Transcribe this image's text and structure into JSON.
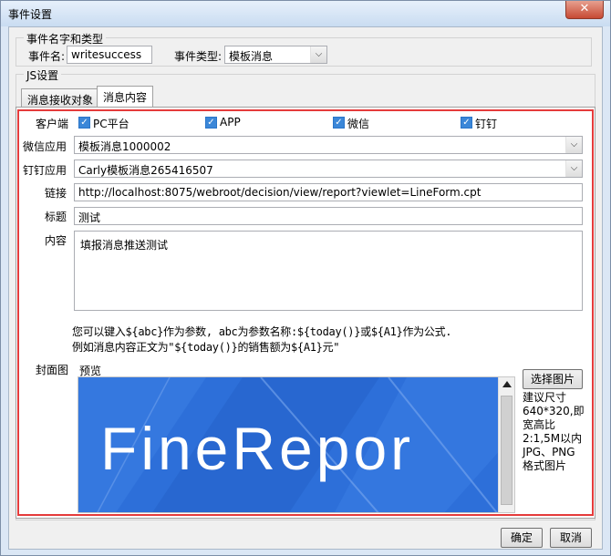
{
  "window": {
    "title": "事件设置",
    "close_symbol": "✕"
  },
  "name_group": {
    "title": "事件名字和类型",
    "name_label": "事件名:",
    "name_value": "writesuccess",
    "type_label": "事件类型:",
    "type_value": "模板消息"
  },
  "js_group": {
    "title": "JS设置"
  },
  "tabs": [
    {
      "label": "消息接收对象"
    },
    {
      "label": "消息内容"
    }
  ],
  "message": {
    "client_label": "客户端",
    "clients": [
      {
        "label": "PC平台",
        "checked": true
      },
      {
        "label": "APP",
        "checked": true
      },
      {
        "label": "微信",
        "checked": true
      },
      {
        "label": "钉钉",
        "checked": true
      }
    ],
    "wechat_app_label": "微信应用",
    "wechat_app_value": "模板消息1000002",
    "dingtalk_app_label": "钉钉应用",
    "dingtalk_app_value": "Carly模板消息265416507",
    "link_label": "链接",
    "link_value": "http://localhost:8075/webroot/decision/view/report?viewlet=LineForm.cpt",
    "title_label": "标题",
    "title_value": "测试",
    "content_label": "内容",
    "content_value": "填报消息推送测试",
    "hint_line1": "您可以键入${abc}作为参数, abc为参数名称:${today()}或${A1}作为公式.",
    "hint_line2": "例如消息内容正文为\"${today()}的销售额为${A1}元\"",
    "cover_label": "封面图",
    "preview_label": "预览",
    "preview_text": "FineRepor",
    "choose_image_label": "选择图片",
    "size_hint": "建议尺寸640*320,即宽高比2:1,5M以内JPG、PNG格式图片"
  },
  "footer": {
    "ok_label": "确定",
    "cancel_label": "取消"
  },
  "colors": {
    "highlight": "#e53b3b",
    "checkbox": "#3b87d8",
    "preview_bg": "#2d6fd9"
  }
}
